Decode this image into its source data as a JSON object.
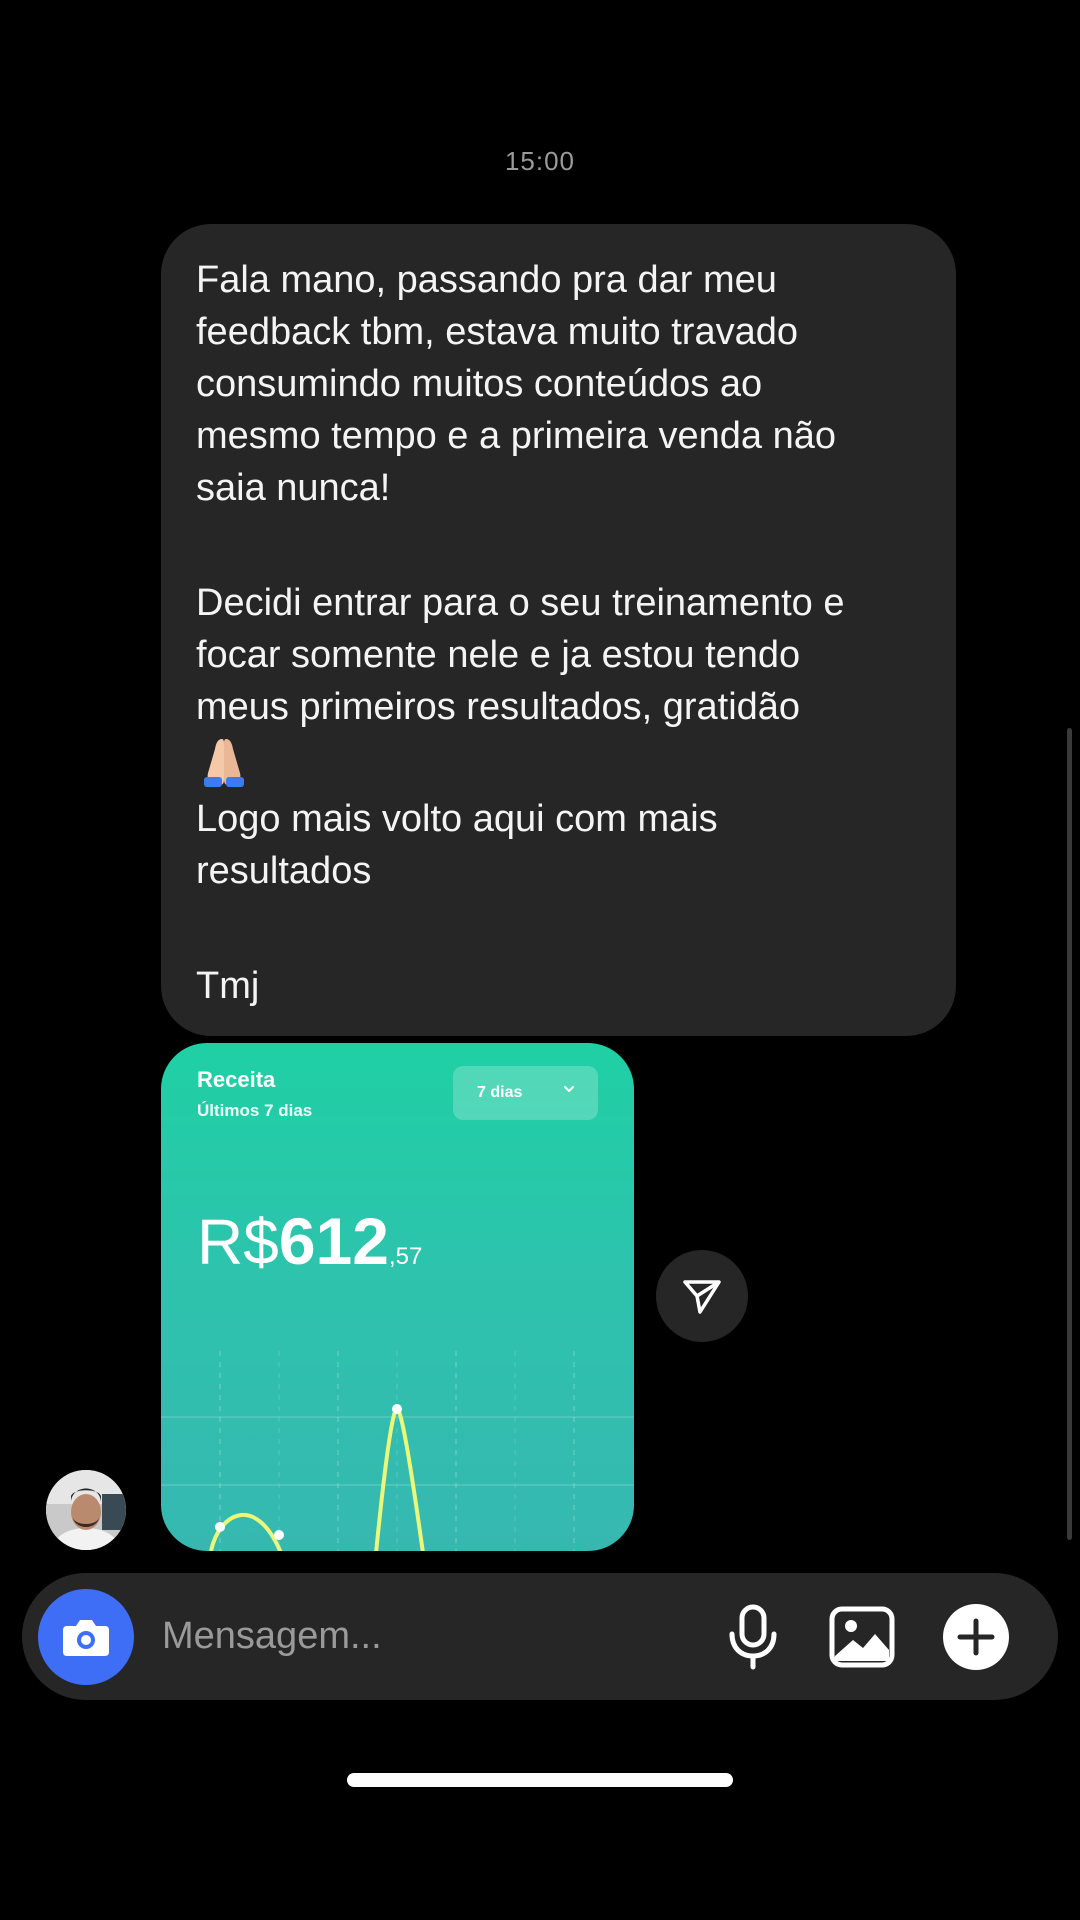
{
  "thread": {
    "timestamp": "15:00"
  },
  "message": {
    "paragraphs": [
      "Fala mano, passando pra dar meu\nfeedback tbm, estava muito travado\nconsumindo muitos conteúdos ao\nmesmo tempo e a primeira venda não\nsaia nunca!",
      "Decidi entrar para o seu treinamento e\nfocar somente nele e ja estou tendo\nmeus primeiros resultados, gratidão",
      "Logo mais volto aqui com mais\nresultados",
      "Tmj"
    ],
    "emoji": "folded-hands-emoji"
  },
  "shared_card": {
    "title": "Receita",
    "subtitle": "Últimos 7 dias",
    "period_label": "7 dias",
    "amount_currency": "R$",
    "amount_integer": "612",
    "amount_cents": ",57",
    "accent_top": "#1fd0a4",
    "accent_bottom": "#36b8b0",
    "chart_data": {
      "type": "line",
      "note": "Revenue curve over the last 7 days, cropped in the screenshot; only two peaks are visible.",
      "series": [
        {
          "values": [
            0,
            0.18,
            0.06,
            0,
            1,
            0,
            0
          ]
        }
      ]
    }
  },
  "composer": {
    "placeholder": "Mensagem...",
    "camera_icon": "camera-icon",
    "mic_icon": "microphone-icon",
    "gallery_icon": "image-icon",
    "add_icon": "plus-icon",
    "camera_color": "#3f6ef6"
  },
  "share_icon": "send-icon",
  "avatar": "user-avatar"
}
